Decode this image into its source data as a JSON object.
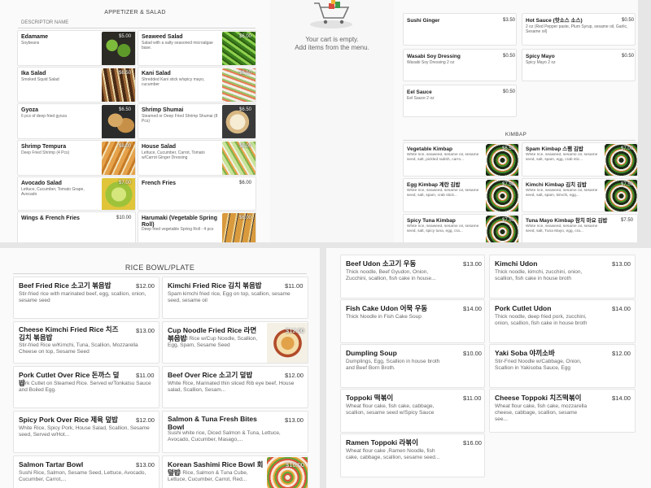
{
  "cart": {
    "empty": "Your cart is empty.",
    "hint": "Add items from the menu."
  },
  "appetizer": {
    "title": "APPETIZER & SALAD",
    "col_header": "DESCRIPTOR NAME",
    "items": [
      {
        "name": "Edamame",
        "desc": "Soybeans",
        "price": "$5.00"
      },
      {
        "name": "Seaweed Salad",
        "desc": "Salad with a salty seasoned microalgae base.",
        "price": "$6.00"
      },
      {
        "name": "Ika Salad",
        "desc": "Smoked Squid Salad",
        "price": "$6.50"
      },
      {
        "name": "Kani Salad",
        "desc": "Shredded Kani stick w/spicy mayo, cucumber",
        "price": "$6.50"
      },
      {
        "name": "Gyoza",
        "desc": "6 pcs of deep fried gyoza",
        "price": "$6.50"
      },
      {
        "name": "Shrimp Shumai",
        "desc": "Steamed or Deep Fried Shrimp Shumai (8 Pcs)",
        "price": "$6.50"
      },
      {
        "name": "Shrimp Tempura",
        "desc": "Deep Fried Shrimp (4 Pcs)",
        "price": "$8.00"
      },
      {
        "name": "House Salad",
        "desc": "Lettuce, Cucumber, Carrot, Tomato w/Carrot Ginger Dressing",
        "price": "$6.00"
      },
      {
        "name": "Avocado Salad",
        "desc": "Lettuce, Cucumber, Tomato Grape, Avocado",
        "price": "$7.00"
      },
      {
        "name": "French Fries",
        "desc": "",
        "price": "$6.00"
      },
      {
        "name": "Wings & French Fries",
        "desc": "",
        "price": "$10.00"
      },
      {
        "name": "Harumaki (Vegetable Spring Roll)",
        "desc": "Deep fried vegetable Spring Roll - 4 pcs",
        "price": "$6.00"
      }
    ]
  },
  "sauces": [
    {
      "name": "Sushi Ginger",
      "desc": "",
      "price": "$3.50"
    },
    {
      "name": "Hot Sauce (핫소스 소스)",
      "desc": "2 oz (Red Pepper paste, Plum Syrup, sesame oil, Garlic, Sesame oil)",
      "price": "$0.50"
    },
    {
      "name": "Wasabi Soy Dressing",
      "desc": "Wasabi Soy Dressing 2 oz",
      "price": "$0.50"
    },
    {
      "name": "Spicy Mayo",
      "desc": "Spicy Mayo 2 oz",
      "price": "$0.50"
    },
    {
      "name": "Eel Sauce",
      "desc": "Eel Sauce 2 oz",
      "price": "$0.50"
    }
  ],
  "kimbap": {
    "title": "KIMBAP",
    "items": [
      {
        "name": "Vegetable Kimbap",
        "desc": "White rice, seaweed, sesame oil, sesame seed, salt, pickled radish, carro...",
        "price": "$6.50"
      },
      {
        "name": "Spam Kimbap 스팸 김밥",
        "desc": "White rice, seaweed, sesame oil, sesame seed, salt, spam, egg, crab stic...",
        "price": "$7.00"
      },
      {
        "name": "Egg Kimbap 계란 김밥",
        "desc": "White rice, seaweed, sesame oil, sesame seed, salt, spam, crab stick...",
        "price": "$7.50"
      },
      {
        "name": "Kimchi Kimbap 김치 김밥",
        "desc": "White rice, seaweed, sesame oil, sesame seed, salt, spam, kimchi, egg...",
        "price": "$7.50"
      },
      {
        "name": "Spicy Tuna Kimbap",
        "desc": "White rice, seaweed, sesame oil, sesame seed, salt, spicy tuna, egg, cra...",
        "price": "$7.50"
      },
      {
        "name": "Tuna Mayo Kimbap 참치 마요 김밥",
        "desc": "White rice, seaweed, sesame oil, sesame seed, salt, Tuna Mayo, egg, cra...",
        "price": "$7.50"
      }
    ]
  },
  "rice": {
    "title": "RICE BOWL/PLATE",
    "items": [
      {
        "name": "Beef Fried Rice 소고기 볶음밥",
        "desc": "Stir-fried rice with marinated beef, egg, scallion, onion, sesame seed",
        "price": "$12.00"
      },
      {
        "name": "Kimchi Fried Rice 김치 볶음밥",
        "desc": "Spam kimchi fried rice, Egg on top, scallion, sesame seed, sesame oil",
        "price": "$11.00"
      },
      {
        "name": "Cheese Kimchi Fried Rice 치즈김치 볶음밥",
        "desc": "Stir-fried Rice w/Kimchi, Tuna, Scallion, Mozzarella Cheese on top, Sesame Seed",
        "price": "$13.00"
      },
      {
        "name": "Cup Noodle Fried Rice 라면 볶음밥",
        "desc": "Stir-fried Rice w/Cup Noodle, Scallion, Egg, Spam, Sesame Seed",
        "price": "$12.00"
      },
      {
        "name": "Pork Cutlet Over Rice 돈까스 덮밥",
        "desc": "Pork Cutlet on Steamed Rice. Served w/Tonkatsu Sauce and Boiled Egg.",
        "price": "$11.00"
      },
      {
        "name": "Beef Over Rice 소고기 덮밥",
        "desc": "White Rice, Marinated thin sliced Rib eye beef, House salad, Scallion, Sesam...",
        "price": "$12.00"
      },
      {
        "name": "Spicy Pork Over Rice 제육 덮밥",
        "desc": "White Rice, Spicy Pork, House Salad, Scallion, Sesame seed, Served w/Hot...",
        "price": "$12.00"
      },
      {
        "name": "Salmon & Tuna Fresh Bites Bowl",
        "desc": "Sushi white rice, Diced Salmon & Tuna, Lettuce, Avocado, Cucumber, Masago,...",
        "price": "$13.00"
      },
      {
        "name": "Salmon Tartar Bowl",
        "desc": "Sushi Rice, Salmon, Sesame Seed, Lettuce, Avocado, Cucumber, Carrot,...",
        "price": "$13.00"
      },
      {
        "name": "Korean Sashimi Rice Bowl 회덮밥",
        "desc": "White Rice, Salmon & Tuna Cube, Lettuce, Cucumber, Carrot, Red...",
        "price": "$16.00"
      }
    ]
  },
  "noodle": {
    "items": [
      {
        "name": "Beef Udon 소고기 우동",
        "desc": "Thick noodle, Beef Gyudon, Onion, Zucchini, scallion, fish cake in house...",
        "price": "$13.00"
      },
      {
        "name": "Kimchi Udon",
        "desc": "Thick noodle, kimchi, zucchini, onion, scallion, fish cake in house broth",
        "price": "$13.00"
      },
      {
        "name": "Fish Cake Udon 어묵 우동",
        "desc": "Thick Noodle in Fish Cake Soup",
        "price": "$14.00"
      },
      {
        "name": "Pork Cutlet Udon",
        "desc": "Thick noodle, deep fried pork, zucchini, onion, scallion, fish cake in house broth",
        "price": "$14.00"
      },
      {
        "name": "Dumpling Soup",
        "desc": "Dumplings, Egg, Scallion in house broth and Beef Born Broth.",
        "price": "$10.00"
      },
      {
        "name": "Yaki Soba 야끼소바",
        "desc": "Stir-Fried Noodle w/Cabbage, Onion, Scallion in Yakisoba Sauce, Egg",
        "price": "$12.00"
      },
      {
        "name": "Toppoki 떡볶이",
        "desc": "Wheat flour cake, fish cake, cabbage, scallion, sesame seed w/Spicy Sauce",
        "price": "$11.00"
      },
      {
        "name": "Cheese Toppoki 치즈떡볶이",
        "desc": "Wheat flour cake, fish cake, mozzarella cheese, cabbage, scallion, sesame see...",
        "price": "$14.00"
      },
      {
        "name": "Ramen Toppoki 라볶이",
        "desc": "Wheat flour cake ,Ramen Noodle, fish cake, cabbage, scallion, sesame seed...",
        "price": "$16.00"
      }
    ]
  }
}
